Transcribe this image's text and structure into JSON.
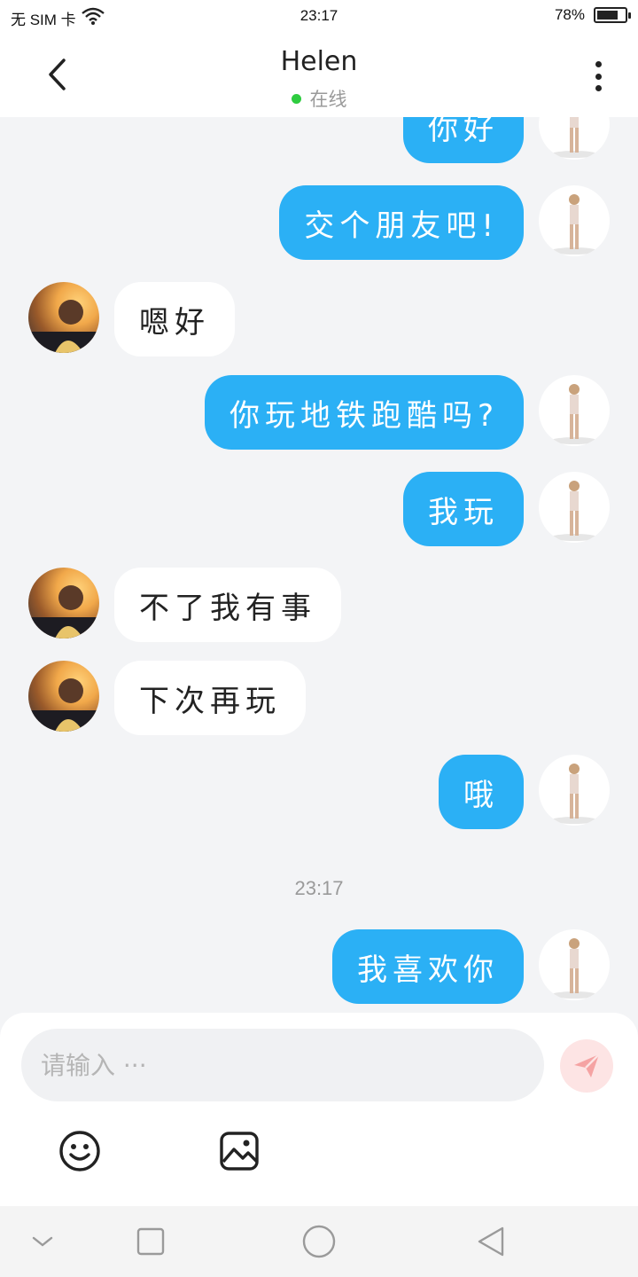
{
  "status_bar": {
    "carrier": "无 SIM 卡",
    "time": "23:17",
    "battery_percent": "78%",
    "battery_level": 0.78
  },
  "header": {
    "title": "Helen",
    "status": "在线",
    "status_color": "#2ecc40"
  },
  "messages": [
    {
      "side": "me",
      "text": "你好"
    },
    {
      "side": "me",
      "text": "交个朋友吧!"
    },
    {
      "side": "other",
      "text": "嗯好"
    },
    {
      "side": "me",
      "text": "你玩地铁跑酷吗?"
    },
    {
      "side": "me",
      "text": "我玩"
    },
    {
      "side": "other",
      "text": "不了我有事"
    },
    {
      "side": "other",
      "text": "下次再玩"
    },
    {
      "side": "me",
      "text": "哦"
    },
    {
      "timestamp": "23:17"
    },
    {
      "side": "me",
      "text": "我喜欢你"
    }
  ],
  "composer": {
    "placeholder": "请输入 ···",
    "send_icon": "send-icon",
    "tools": [
      "emoji-icon",
      "image-icon"
    ]
  },
  "nav_bar": {
    "buttons": [
      "chevron-down-icon",
      "recents-square-icon",
      "home-circle-icon",
      "back-triangle-icon"
    ]
  },
  "colors": {
    "bubble_me": "#2bb0f5",
    "bubble_other": "#ffffff",
    "background": "#f3f4f6",
    "send_button": "#fde4e4"
  }
}
